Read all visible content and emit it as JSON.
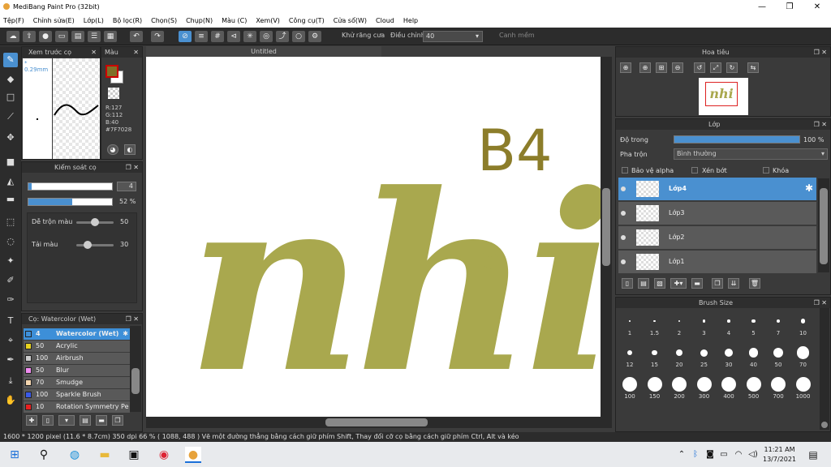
{
  "app": {
    "title": "MediBang Paint Pro (32bit)"
  },
  "window_buttons": [
    "—",
    "❐",
    "✕"
  ],
  "menu": [
    "Tệp(F)",
    "Chỉnh sửa(E)",
    "Lớp(L)",
    "Bộ lọc(R)",
    "Chọn(S)",
    "Chụp(N)",
    "Màu (C)",
    "Xem(V)",
    "Công cụ(T)",
    "Cửa sổ(W)",
    "Cloud",
    "Help"
  ],
  "toolbar": {
    "antialias_label": "Khử răng cưa",
    "adjust_label": "Điều chỉnh",
    "adjust_value": "40",
    "edge_label": "Canh mềm"
  },
  "canvas": {
    "tab_title": "Untitled"
  },
  "preview_panel": {
    "title": "Xem trước cọ",
    "size_label": "* 0.29mm"
  },
  "color_panel": {
    "title": "Màu",
    "r": "R:127",
    "g": "G:112",
    "b": "B:40",
    "hex": "#7F7028",
    "main_color": "#7F7028"
  },
  "brush_control": {
    "title": "Kiểm soát cọ",
    "size_value": "4",
    "opacity_value": "52 %",
    "opacity_fraction": 0.52,
    "blend_label": "Dễ trộn màu",
    "blend_value": "50",
    "blend_fraction": 0.5,
    "paint_label": "Tải màu",
    "paint_value": "30",
    "paint_fraction": 0.3
  },
  "brush_list": {
    "title": "Cọ: Watercolor (Wet)",
    "items": [
      {
        "size": "4",
        "name": "Watercolor (Wet)",
        "color": "#3d8fd8"
      },
      {
        "size": "50",
        "name": "Acrylic",
        "color": "#e8d21e"
      },
      {
        "size": "100",
        "name": "Airbrush",
        "color": "#cccccc"
      },
      {
        "size": "50",
        "name": "Blur",
        "color": "#f08cf0"
      },
      {
        "size": "70",
        "name": "Smudge",
        "color": "#f4d6b0"
      },
      {
        "size": "100",
        "name": "Sparkle Brush",
        "color": "#3a5ae8"
      },
      {
        "size": "10",
        "name": "Rotation Symmetry Pe",
        "color": "#e82020"
      }
    ]
  },
  "navigator": {
    "title": "Hoa tiêu"
  },
  "layers": {
    "title": "Lớp",
    "opacity_label": "Độ trong",
    "opacity_value": "100 %",
    "opacity_fraction": 1.0,
    "blend_label": "Pha trộn",
    "blend_value": "Bình thường",
    "protect_alpha": "Bảo vệ alpha",
    "clipping": "Xén bớt",
    "lock": "Khóa",
    "items": [
      "Lớp4",
      "Lớp3",
      "Lớp2",
      "Lớp1"
    ]
  },
  "brush_size": {
    "title": "Brush Size",
    "sizes": [
      "1",
      "1.5",
      "2",
      "3",
      "4",
      "5",
      "7",
      "10",
      "12",
      "15",
      "20",
      "25",
      "30",
      "40",
      "50",
      "70",
      "100",
      "150",
      "200",
      "300",
      "400",
      "500",
      "700",
      "1000"
    ]
  },
  "status": {
    "text": "1600 * 1200 pixel   (11.6 * 8.7cm)   350 dpi   66 %   ( 1088, 488 )   Vẽ một đường thẳng bằng cách giữ phím Shift, Thay đổi cỡ cọ bằng cách giữ phím Ctrl, Alt và kéo"
  },
  "taskbar": {
    "time": "11:21 AM",
    "date": "13/7/2021"
  },
  "artwork": {
    "main_text": "nhi",
    "corner_text": "B4",
    "main_color": "#a9a84e",
    "corner_color": "#8c7d2a"
  }
}
